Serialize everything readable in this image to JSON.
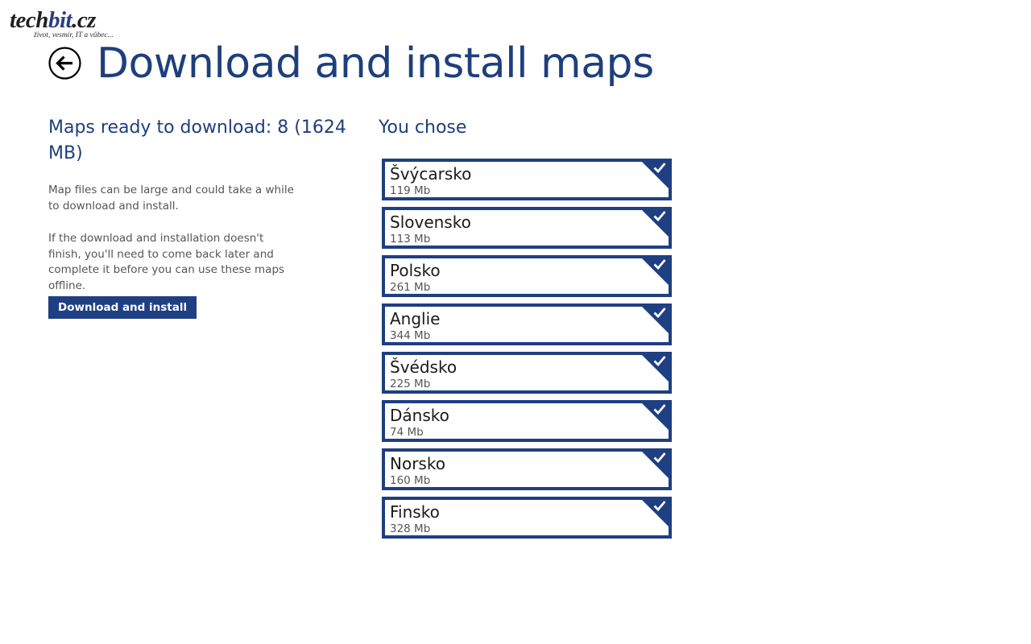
{
  "watermark": {
    "brand_prefix": "tech",
    "brand_highlight": "bit",
    "brand_suffix": ".cz",
    "tagline": "život, vesmír, IT a vůbec..."
  },
  "header": {
    "back_icon": "back-arrow-icon",
    "title": "Download and install maps"
  },
  "summary": {
    "heading": "Maps ready to download: 8 (1624 MB)",
    "paragraph_1": "Map files can be large and could take a while to download and install.",
    "paragraph_2": "If the download and installation doesn't finish, you'll need to come back later and complete it before you can use these maps offline.",
    "button_label": "Download and install"
  },
  "selection": {
    "heading": "You chose",
    "check_icon": "checkmark-icon",
    "items": [
      {
        "name": "Švýcarsko",
        "size": "119 Mb",
        "selected": true
      },
      {
        "name": "Slovensko",
        "size": "113 Mb",
        "selected": true
      },
      {
        "name": "Polsko",
        "size": "261 Mb",
        "selected": true
      },
      {
        "name": "Anglie",
        "size": "344 Mb",
        "selected": true
      },
      {
        "name": "Švédsko",
        "size": "225 Mb",
        "selected": true
      },
      {
        "name": "Dánsko",
        "size": "74 Mb",
        "selected": true
      },
      {
        "name": "Norsko",
        "size": "160 Mb",
        "selected": true
      },
      {
        "name": "Finsko",
        "size": "328 Mb",
        "selected": true
      }
    ]
  },
  "colors": {
    "accent": "#1e3f82",
    "title": "#1e3f7c",
    "body_text": "#555555",
    "background": "#ffffff"
  }
}
